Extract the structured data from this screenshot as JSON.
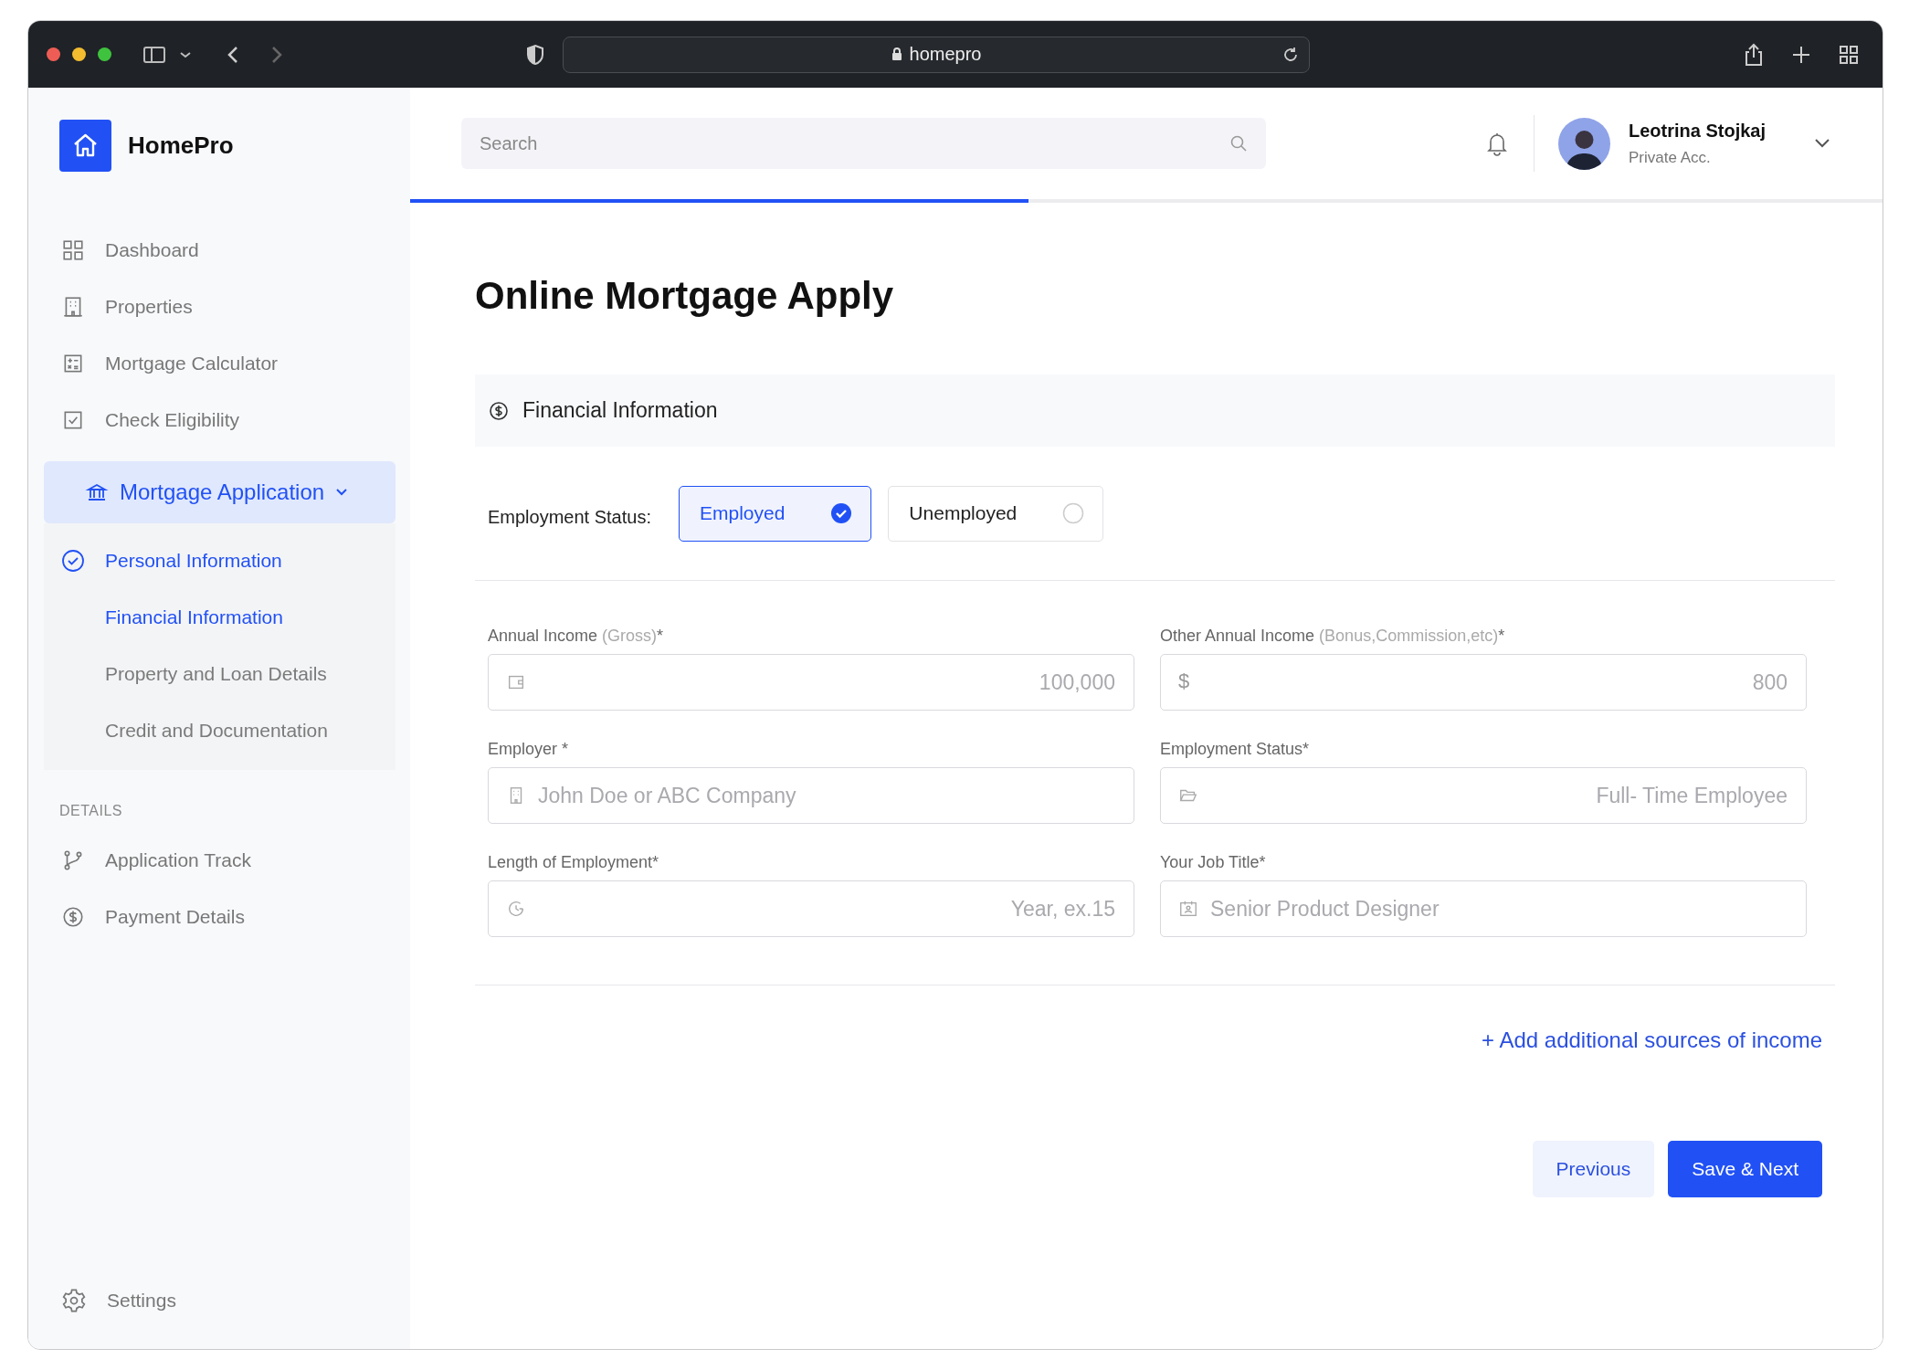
{
  "browser": {
    "address": "homepro"
  },
  "brand": {
    "name": "HomePro"
  },
  "nav": [
    {
      "label": "Dashboard"
    },
    {
      "label": "Properties"
    },
    {
      "label": "Mortgage Calculator"
    },
    {
      "label": "Check Eligibility"
    }
  ],
  "mortgage_menu": {
    "label": "Mortgage Application",
    "expanded": true,
    "children": [
      {
        "label": "Personal Information",
        "kind": "done"
      },
      {
        "label": "Financial Information",
        "kind": "current"
      },
      {
        "label": "Property and Loan Details",
        "kind": "pending"
      },
      {
        "label": "Credit and Documentation",
        "kind": "pending"
      }
    ]
  },
  "details": {
    "heading": "DETAILS",
    "items": [
      {
        "label": "Application Track"
      },
      {
        "label": "Payment Details"
      }
    ]
  },
  "settings": {
    "label": "Settings"
  },
  "header": {
    "search": {
      "placeholder": "Search"
    },
    "user": {
      "name": "Leotrina Stojkaj",
      "account": "Private Acc."
    }
  },
  "progress": {
    "level": 0.42
  },
  "page_title": "Online Mortgage Apply",
  "section": {
    "title": "Financial Information"
  },
  "employment": {
    "label": "Employment Status:",
    "options": [
      {
        "label": "Employed",
        "selected": true
      },
      {
        "label": "Unemployed",
        "selected": false
      }
    ]
  },
  "fields": [
    {
      "label": "Annual Income",
      "note": "(Gross)",
      "label_end": "*",
      "placeholder": "100,000",
      "kind": "number"
    },
    {
      "label": "Other Annual Income",
      "note": "(Bonus,Commission,etc)",
      "label_end": "*",
      "prefix": "$",
      "placeholder": "800",
      "kind": "number"
    },
    {
      "label": "Employer *",
      "placeholder": "John Doe or ABC Company",
      "kind": "text"
    },
    {
      "label": "Employment Status*",
      "placeholder": "Full- Time Employee",
      "kind": "select"
    },
    {
      "label": "Length of Employment*",
      "placeholder": "Year, ex.15",
      "kind": "number"
    },
    {
      "label": "Your Job Title*",
      "placeholder": "Senior Product Designer",
      "kind": "text"
    }
  ],
  "add_link": "+ Add additional sources of income",
  "buttons": [
    {
      "label": "Previous",
      "kind": "secondary"
    },
    {
      "label": "Save & Next",
      "kind": "primary"
    }
  ]
}
